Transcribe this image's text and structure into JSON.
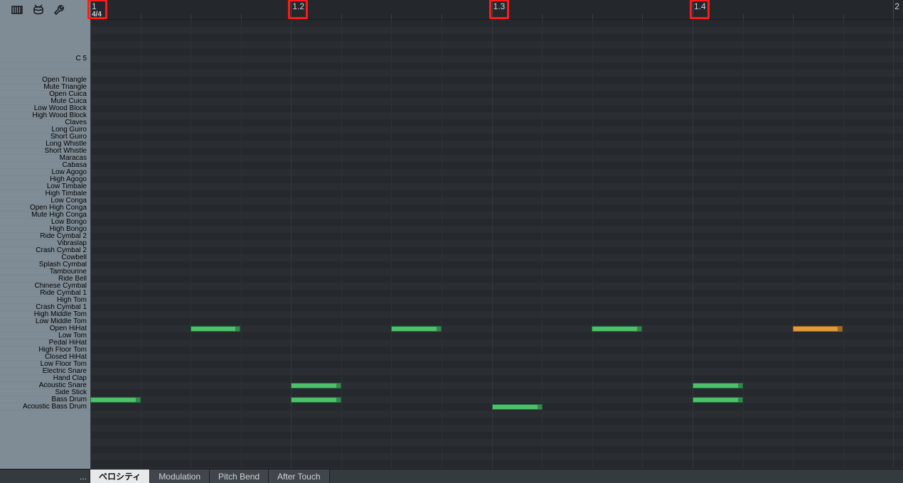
{
  "ruler": {
    "time_signature": "4/4",
    "beats": [
      "1",
      "1.2",
      "1.3",
      "1.4",
      "2"
    ],
    "beat_positions": [
      0.0,
      0.247,
      0.494,
      0.741,
      0.988
    ],
    "highlight_boxes": [
      0.0,
      0.247,
      0.494,
      0.741
    ],
    "subdivisions_per_beat": 4
  },
  "lanes": {
    "top_offset_rows": 5,
    "labels": [
      "C 5",
      "",
      "",
      "Open Triangle",
      "Mute Triangle",
      "Open Cuica",
      "Mute Cuica",
      "Low Wood Block",
      "High Wood Block",
      "Claves",
      "Long Guiro",
      "Short Guiro",
      "Long Whistle",
      "Short Whistle",
      "Maracas",
      "Cabasa",
      "Low Agogo",
      "High Agogo",
      "Low Timbale",
      "High Timbale",
      "Low Conga",
      "Open High Conga",
      "Mute High Conga",
      "Low Bongo",
      "High Bongo",
      "Ride Cymbal 2",
      "Vibraslap",
      "Crash Cymbal 2",
      "Cowbell",
      "Splash Cymbal",
      "Tambourine",
      "Ride Bell",
      "Chinese Cymbal",
      "Ride Cymbal 1",
      "High Tom",
      "Crash Cymbal 1",
      "High Middle Tom",
      "Low Middle Tom",
      "Open HiHat",
      "Low Tom",
      "Pedal HiHat",
      "High Floor Tom",
      "Closed HiHat",
      "Low Floor Tom",
      "Electric Snare",
      "Hand Clap",
      "Acoustic Snare",
      "Side Stick",
      "Bass Drum",
      "Acoustic Bass Drum"
    ]
  },
  "notes": [
    {
      "lane": "Open HiHat",
      "start_frac": 0.123,
      "len_frac": 0.062,
      "color": "green"
    },
    {
      "lane": "Open HiHat",
      "start_frac": 0.37,
      "len_frac": 0.062,
      "color": "green"
    },
    {
      "lane": "Open HiHat",
      "start_frac": 0.617,
      "len_frac": 0.062,
      "color": "green"
    },
    {
      "lane": "Open HiHat",
      "start_frac": 0.864,
      "len_frac": 0.062,
      "color": "orange"
    },
    {
      "lane": "Acoustic Snare",
      "start_frac": 0.247,
      "len_frac": 0.062,
      "color": "green"
    },
    {
      "lane": "Acoustic Snare",
      "start_frac": 0.741,
      "len_frac": 0.062,
      "color": "green"
    },
    {
      "lane": "Bass Drum",
      "start_frac": 0.0,
      "len_frac": 0.062,
      "color": "green"
    },
    {
      "lane": "Bass Drum",
      "start_frac": 0.247,
      "len_frac": 0.062,
      "color": "green"
    },
    {
      "lane": "Bass Drum",
      "start_frac": 0.741,
      "len_frac": 0.062,
      "color": "green"
    },
    {
      "lane": "Acoustic Bass Drum",
      "start_frac": 0.494,
      "len_frac": 0.062,
      "color": "green"
    }
  ],
  "bottom_tabs": {
    "ellipsis": "...",
    "items": [
      "ベロシティ",
      "Modulation",
      "Pitch Bend",
      "After Touch"
    ],
    "active_index": 0
  },
  "toolbar_icons": [
    "piano-icon",
    "drum-icon",
    "wrench-icon"
  ]
}
